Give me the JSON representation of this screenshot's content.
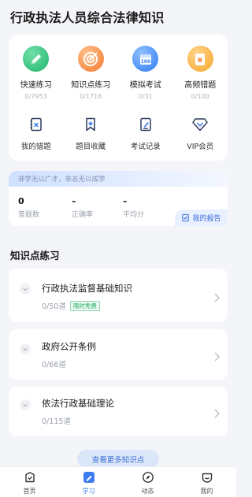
{
  "page": {
    "title": "行政执法人员综合法律知识"
  },
  "features_main": [
    {
      "label": "快速练习",
      "count": "0/7953",
      "icon": "pencil-icon",
      "color": "#21b36d"
    },
    {
      "label": "知识点练习",
      "count": "0/1716",
      "icon": "target-icon",
      "color": "#f47a2f"
    },
    {
      "label": "模拟考试",
      "count": "0/31",
      "icon": "calendar-100-icon",
      "color": "#2f7cf2"
    },
    {
      "label": "高频错题",
      "count": "0/100",
      "icon": "error-card-icon",
      "color": "#f6a52a"
    }
  ],
  "features_sub": [
    {
      "label": "我的错题",
      "icon": "wrong-notebook-icon"
    },
    {
      "label": "题目收藏",
      "icon": "bookmark-icon"
    },
    {
      "label": "考试记录",
      "icon": "exam-record-icon"
    },
    {
      "label": "VIP会员",
      "icon": "diamond-icon"
    }
  ],
  "stats": {
    "motto": "非学无以广才，非志无以成学",
    "answered_value": "0",
    "answered_label": "答题数",
    "accuracy_value": "–",
    "accuracy_label": "正确率",
    "average_value": "–",
    "average_label": "平均分",
    "report_label": "我的报告"
  },
  "knowledge": {
    "section_title": "知识点练习",
    "items": [
      {
        "name": "行政执法监督基础知识",
        "count": "0/50道",
        "badge": "限时免费"
      },
      {
        "name": "政府公开条例",
        "count": "0/66道"
      },
      {
        "name": "依法行政基础理论",
        "count": "0/115道"
      }
    ],
    "more_label": "查看更多知识点"
  },
  "tabbar": {
    "active": "学习",
    "items": [
      {
        "label": "首页",
        "icon": "home-icon"
      },
      {
        "label": "学习",
        "icon": "study-icon"
      },
      {
        "label": "动态",
        "icon": "compass-icon"
      },
      {
        "label": "我的",
        "icon": "profile-icon"
      }
    ]
  },
  "colors": {
    "accent": "#3d7bf0",
    "free_badge": "#1aa85c"
  }
}
